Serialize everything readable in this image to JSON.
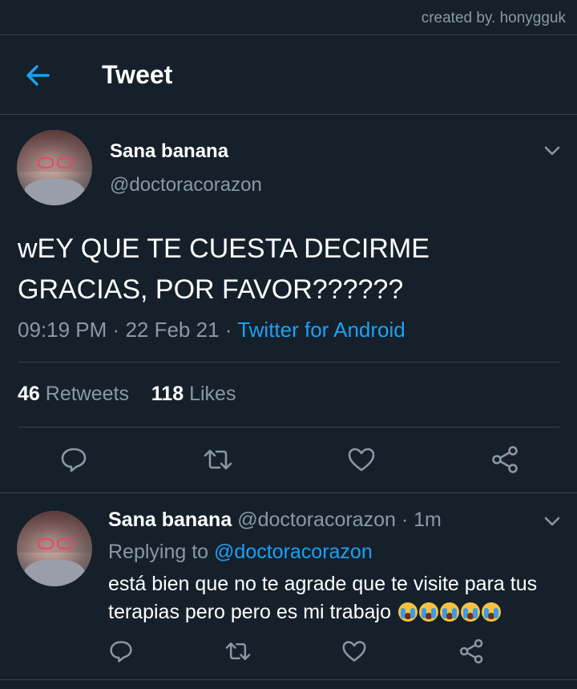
{
  "credit": "created by. honygguk",
  "header": {
    "title": "Tweet",
    "back_icon": "arrow-left-icon"
  },
  "colors": {
    "background": "#15202b",
    "accent": "#1da1f2",
    "muted": "#8899a6",
    "divider": "#38444d"
  },
  "main_tweet": {
    "display_name": "Sana banana",
    "handle": "@doctoracorazon",
    "text": "wEY QUE TE CUESTA DECIRME GRACIAS, POR FAVOR??????",
    "time": "09:19 PM",
    "date": "22 Feb 21",
    "separator": "·",
    "source": "Twitter for Android",
    "retweets_count": "46",
    "retweets_label": "Retweets",
    "likes_count": "118",
    "likes_label": "Likes"
  },
  "reply_tweet": {
    "display_name": "Sana banana",
    "handle": "@doctoracorazon",
    "separator": "·",
    "time_ago": "1m",
    "replying_to_label": "Replying to",
    "replying_to_handle": "@doctoracorazon",
    "text": "está bien que no te agrade que te visite para tus terapias pero pero es mi trabajo",
    "emoji_count": 5,
    "emoji_name": "loudly-crying-face"
  },
  "actions": [
    "comment-icon",
    "retweet-icon",
    "like-icon",
    "share-icon"
  ]
}
